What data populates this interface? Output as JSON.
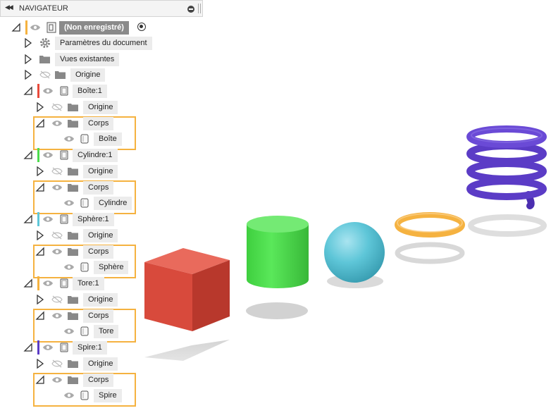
{
  "header": {
    "title": "NAVIGATEUR"
  },
  "tree": {
    "root": "(Non enregistré)",
    "document_settings": "Paramètres du document",
    "named_views": "Vues existantes",
    "origin": "Origine",
    "box": {
      "name": "Boîte:1",
      "origin": "Origine",
      "bodies": "Corps",
      "body": "Boîte"
    },
    "cylinder": {
      "name": "Cylindre:1",
      "origin": "Origine",
      "bodies": "Corps",
      "body": "Cylindre"
    },
    "sphere": {
      "name": "Sphère:1",
      "origin": "Origine",
      "bodies": "Corps",
      "body": "Sphère"
    },
    "torus": {
      "name": "Tore:1",
      "origin": "Origine",
      "bodies": "Corps",
      "body": "Tore"
    },
    "coil": {
      "name": "Spire:1",
      "origin": "Origine",
      "bodies": "Corps",
      "body": "Spire"
    }
  },
  "colors": {
    "box": "#e84a3c",
    "cylinder": "#4ddc4d",
    "sphere": "#5ec6d8",
    "torus": "#f5b240",
    "coil": "#5b3cc6",
    "highlight": "#f5b240"
  }
}
